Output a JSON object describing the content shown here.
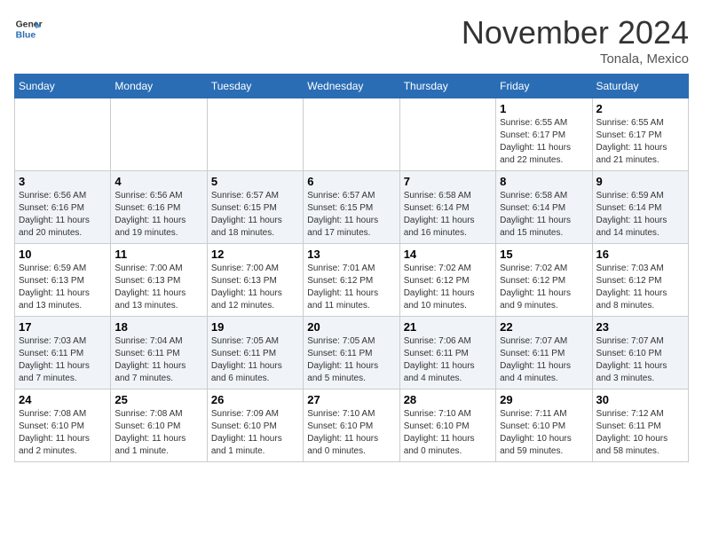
{
  "header": {
    "logo_line1": "General",
    "logo_line2": "Blue",
    "month_title": "November 2024",
    "location": "Tonala, Mexico"
  },
  "weekdays": [
    "Sunday",
    "Monday",
    "Tuesday",
    "Wednesday",
    "Thursday",
    "Friday",
    "Saturday"
  ],
  "weeks": [
    [
      {
        "day": "",
        "info": ""
      },
      {
        "day": "",
        "info": ""
      },
      {
        "day": "",
        "info": ""
      },
      {
        "day": "",
        "info": ""
      },
      {
        "day": "",
        "info": ""
      },
      {
        "day": "1",
        "info": "Sunrise: 6:55 AM\nSunset: 6:17 PM\nDaylight: 11 hours\nand 22 minutes."
      },
      {
        "day": "2",
        "info": "Sunrise: 6:55 AM\nSunset: 6:17 PM\nDaylight: 11 hours\nand 21 minutes."
      }
    ],
    [
      {
        "day": "3",
        "info": "Sunrise: 6:56 AM\nSunset: 6:16 PM\nDaylight: 11 hours\nand 20 minutes."
      },
      {
        "day": "4",
        "info": "Sunrise: 6:56 AM\nSunset: 6:16 PM\nDaylight: 11 hours\nand 19 minutes."
      },
      {
        "day": "5",
        "info": "Sunrise: 6:57 AM\nSunset: 6:15 PM\nDaylight: 11 hours\nand 18 minutes."
      },
      {
        "day": "6",
        "info": "Sunrise: 6:57 AM\nSunset: 6:15 PM\nDaylight: 11 hours\nand 17 minutes."
      },
      {
        "day": "7",
        "info": "Sunrise: 6:58 AM\nSunset: 6:14 PM\nDaylight: 11 hours\nand 16 minutes."
      },
      {
        "day": "8",
        "info": "Sunrise: 6:58 AM\nSunset: 6:14 PM\nDaylight: 11 hours\nand 15 minutes."
      },
      {
        "day": "9",
        "info": "Sunrise: 6:59 AM\nSunset: 6:14 PM\nDaylight: 11 hours\nand 14 minutes."
      }
    ],
    [
      {
        "day": "10",
        "info": "Sunrise: 6:59 AM\nSunset: 6:13 PM\nDaylight: 11 hours\nand 13 minutes."
      },
      {
        "day": "11",
        "info": "Sunrise: 7:00 AM\nSunset: 6:13 PM\nDaylight: 11 hours\nand 13 minutes."
      },
      {
        "day": "12",
        "info": "Sunrise: 7:00 AM\nSunset: 6:13 PM\nDaylight: 11 hours\nand 12 minutes."
      },
      {
        "day": "13",
        "info": "Sunrise: 7:01 AM\nSunset: 6:12 PM\nDaylight: 11 hours\nand 11 minutes."
      },
      {
        "day": "14",
        "info": "Sunrise: 7:02 AM\nSunset: 6:12 PM\nDaylight: 11 hours\nand 10 minutes."
      },
      {
        "day": "15",
        "info": "Sunrise: 7:02 AM\nSunset: 6:12 PM\nDaylight: 11 hours\nand 9 minutes."
      },
      {
        "day": "16",
        "info": "Sunrise: 7:03 AM\nSunset: 6:12 PM\nDaylight: 11 hours\nand 8 minutes."
      }
    ],
    [
      {
        "day": "17",
        "info": "Sunrise: 7:03 AM\nSunset: 6:11 PM\nDaylight: 11 hours\nand 7 minutes."
      },
      {
        "day": "18",
        "info": "Sunrise: 7:04 AM\nSunset: 6:11 PM\nDaylight: 11 hours\nand 7 minutes."
      },
      {
        "day": "19",
        "info": "Sunrise: 7:05 AM\nSunset: 6:11 PM\nDaylight: 11 hours\nand 6 minutes."
      },
      {
        "day": "20",
        "info": "Sunrise: 7:05 AM\nSunset: 6:11 PM\nDaylight: 11 hours\nand 5 minutes."
      },
      {
        "day": "21",
        "info": "Sunrise: 7:06 AM\nSunset: 6:11 PM\nDaylight: 11 hours\nand 4 minutes."
      },
      {
        "day": "22",
        "info": "Sunrise: 7:07 AM\nSunset: 6:11 PM\nDaylight: 11 hours\nand 4 minutes."
      },
      {
        "day": "23",
        "info": "Sunrise: 7:07 AM\nSunset: 6:10 PM\nDaylight: 11 hours\nand 3 minutes."
      }
    ],
    [
      {
        "day": "24",
        "info": "Sunrise: 7:08 AM\nSunset: 6:10 PM\nDaylight: 11 hours\nand 2 minutes."
      },
      {
        "day": "25",
        "info": "Sunrise: 7:08 AM\nSunset: 6:10 PM\nDaylight: 11 hours\nand 1 minute."
      },
      {
        "day": "26",
        "info": "Sunrise: 7:09 AM\nSunset: 6:10 PM\nDaylight: 11 hours\nand 1 minute."
      },
      {
        "day": "27",
        "info": "Sunrise: 7:10 AM\nSunset: 6:10 PM\nDaylight: 11 hours\nand 0 minutes."
      },
      {
        "day": "28",
        "info": "Sunrise: 7:10 AM\nSunset: 6:10 PM\nDaylight: 11 hours\nand 0 minutes."
      },
      {
        "day": "29",
        "info": "Sunrise: 7:11 AM\nSunset: 6:10 PM\nDaylight: 10 hours\nand 59 minutes."
      },
      {
        "day": "30",
        "info": "Sunrise: 7:12 AM\nSunset: 6:11 PM\nDaylight: 10 hours\nand 58 minutes."
      }
    ]
  ]
}
